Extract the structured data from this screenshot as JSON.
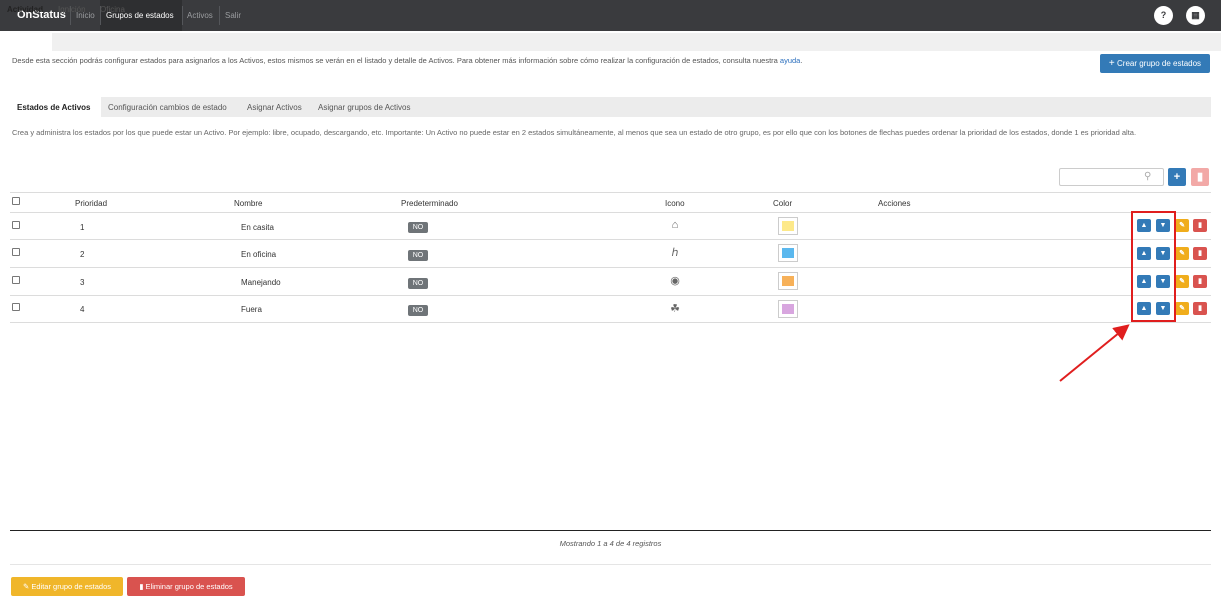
{
  "nav": {
    "brand": "OnStatus",
    "links": [
      "Inicio",
      "Grupos de estados",
      "Activos",
      "Salir"
    ],
    "help_icon": "question-icon",
    "menu_icon": "grid-menu-icon"
  },
  "top_tabs": [
    "Actividad",
    "Ignición",
    "Oficina"
  ],
  "intro": {
    "text": "Desde esta sección podrás configurar estados para asignarlos a los Activos, estos mismos se verán en el listado y detalle de Activos. Para obtener más información sobre cómo realizar la configuración de estados, consulta nuestra ",
    "link": "ayuda",
    "suffix": "."
  },
  "create_button": "Crear grupo de estados",
  "sub_tabs": [
    "Estados de Activos",
    "Configuración cambios de estado",
    "Asignar Activos",
    "Asignar grupos de Activos"
  ],
  "description": "Crea y administra los estados por los que puede estar un Activo. Por ejemplo: libre, ocupado, descargando, etc. Importante: Un Activo no puede estar en 2 estados simultáneamente, al menos que sea un estado de otro grupo, es por ello que con los botones de flechas puedes ordenar la prioridad de los estados, donde 1 es prioridad alta.",
  "search": {
    "placeholder": ""
  },
  "table": {
    "headers": [
      "Prioridad",
      "Nombre",
      "Predeterminado",
      "Icono",
      "Color",
      "Acciones"
    ],
    "rows": [
      {
        "priority": "1",
        "name": "En casita",
        "default": "NO",
        "icon": "home-icon",
        "color": "#fde98a"
      },
      {
        "priority": "2",
        "name": "En oficina",
        "default": "NO",
        "icon": "paperclip-icon",
        "color": "#5bb8ee"
      },
      {
        "priority": "3",
        "name": "Manejando",
        "default": "NO",
        "icon": "steering-wheel-icon",
        "color": "#f7b159"
      },
      {
        "priority": "4",
        "name": "Fuera",
        "default": "NO",
        "icon": "paw-icon",
        "color": "#d8a6df"
      }
    ]
  },
  "showing_text": "Mostrando 1 a 4 de 4 registros",
  "footer_buttons": {
    "edit": "Editar grupo de estados",
    "delete": "Eliminar grupo de estados"
  },
  "colors": {
    "primary": "#337ab7",
    "warning": "#f0ad1c",
    "danger": "#d9534f",
    "annotation": "#e01e1e"
  }
}
